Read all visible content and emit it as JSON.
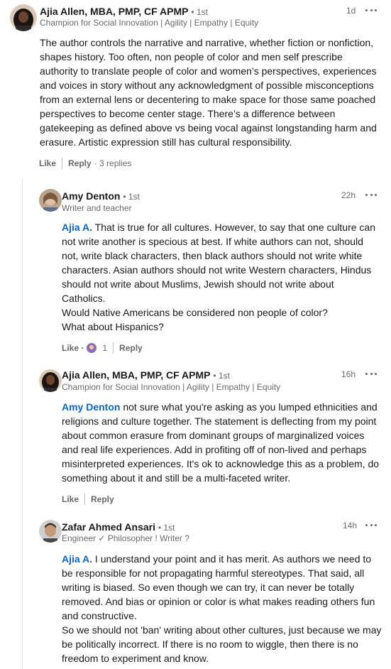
{
  "comments": [
    {
      "author": "Ajia Allen, MBA, PMP, CF APMP",
      "degree": "• 1st",
      "headline": "Champion for Social Innovation | Agility | Empathy | Equity",
      "time": "1d",
      "mention": "",
      "lines": [
        "The author controls the narrative and narrative, whether fiction or nonfiction,",
        "shapes history. Too often, non people of color and men self prescribe",
        "authority to translate people of color and women’s perspectives, experiences",
        "and voices in story without any acknowledgment of possible misconceptions",
        "from an external lens or decentering to make space for those same poached",
        "perspectives to become center stage. There’s a difference between",
        "gatekeeping as defined above vs being vocal against longstanding harm and",
        "erasure. Artistic expression still has cultural responsibility."
      ],
      "like_label": "Like",
      "reply_label": "Reply",
      "replies_count": "· 3 replies"
    },
    {
      "author": "Amy Denton",
      "degree": "• 1st",
      "headline": "Writer and teacher",
      "time": "22h",
      "mention": "Ajia A.",
      "lines": [
        " That is true for all cultures. However, to say that one culture can",
        "not write another is specious at best. If white authors can not, should",
        "not, write black characters, then black authors should not write white",
        "characters. Asian authors should not write Western characters, Hindus",
        "should not write about Muslims, Jewish should not write about",
        "Catholics.",
        "Would Native Americans be considered non people of color?",
        "What about Hispanics?"
      ],
      "like_label": "Like ·",
      "reaction_count": "1",
      "reply_label": "Reply"
    },
    {
      "author": "Ajia Allen, MBA, PMP, CF APMP",
      "degree": "• 1st",
      "headline": "Champion for Social Innovation | Agility | Empathy | Equity",
      "time": "16h",
      "mention": "Amy Denton",
      "lines": [
        " not sure what you're asking as you lumped ethnicities and",
        "religions and culture together. The statement is deflecting from my point",
        "about common erasure from dominant groups of marginalized voices",
        "and real life experiences. Add in profiting off of non-lived and perhaps",
        "misinterpreted experiences. It's ok to acknowledge this as a problem, do",
        "something about it and still be a multi-faceted writer."
      ],
      "like_label": "Like",
      "reply_label": "Reply"
    },
    {
      "author": "Zafar Ahmed Ansari",
      "degree": "• 1st",
      "headline": "Engineer ✓ Philosopher ! Writer ?",
      "time": "14h",
      "mention": "Ajia A.",
      "lines": [
        " I understand your point and it has merit. As authors we need to",
        "be responsible for not propagating harmful stereotypes. That said, all",
        "writing is biased. So even though we can try, it can never be totally",
        "removed. And bias or opinion or color is what makes reading others fun",
        "and constructive.",
        "So we should not 'ban' writing about other cultures, just because we may",
        "be politically incorrect. If there is no room to wiggle, then there is no",
        "freedom to experiment and know."
      ]
    }
  ],
  "icons": {
    "more": "ellipsis-icon",
    "reaction": "support-reaction-icon"
  }
}
